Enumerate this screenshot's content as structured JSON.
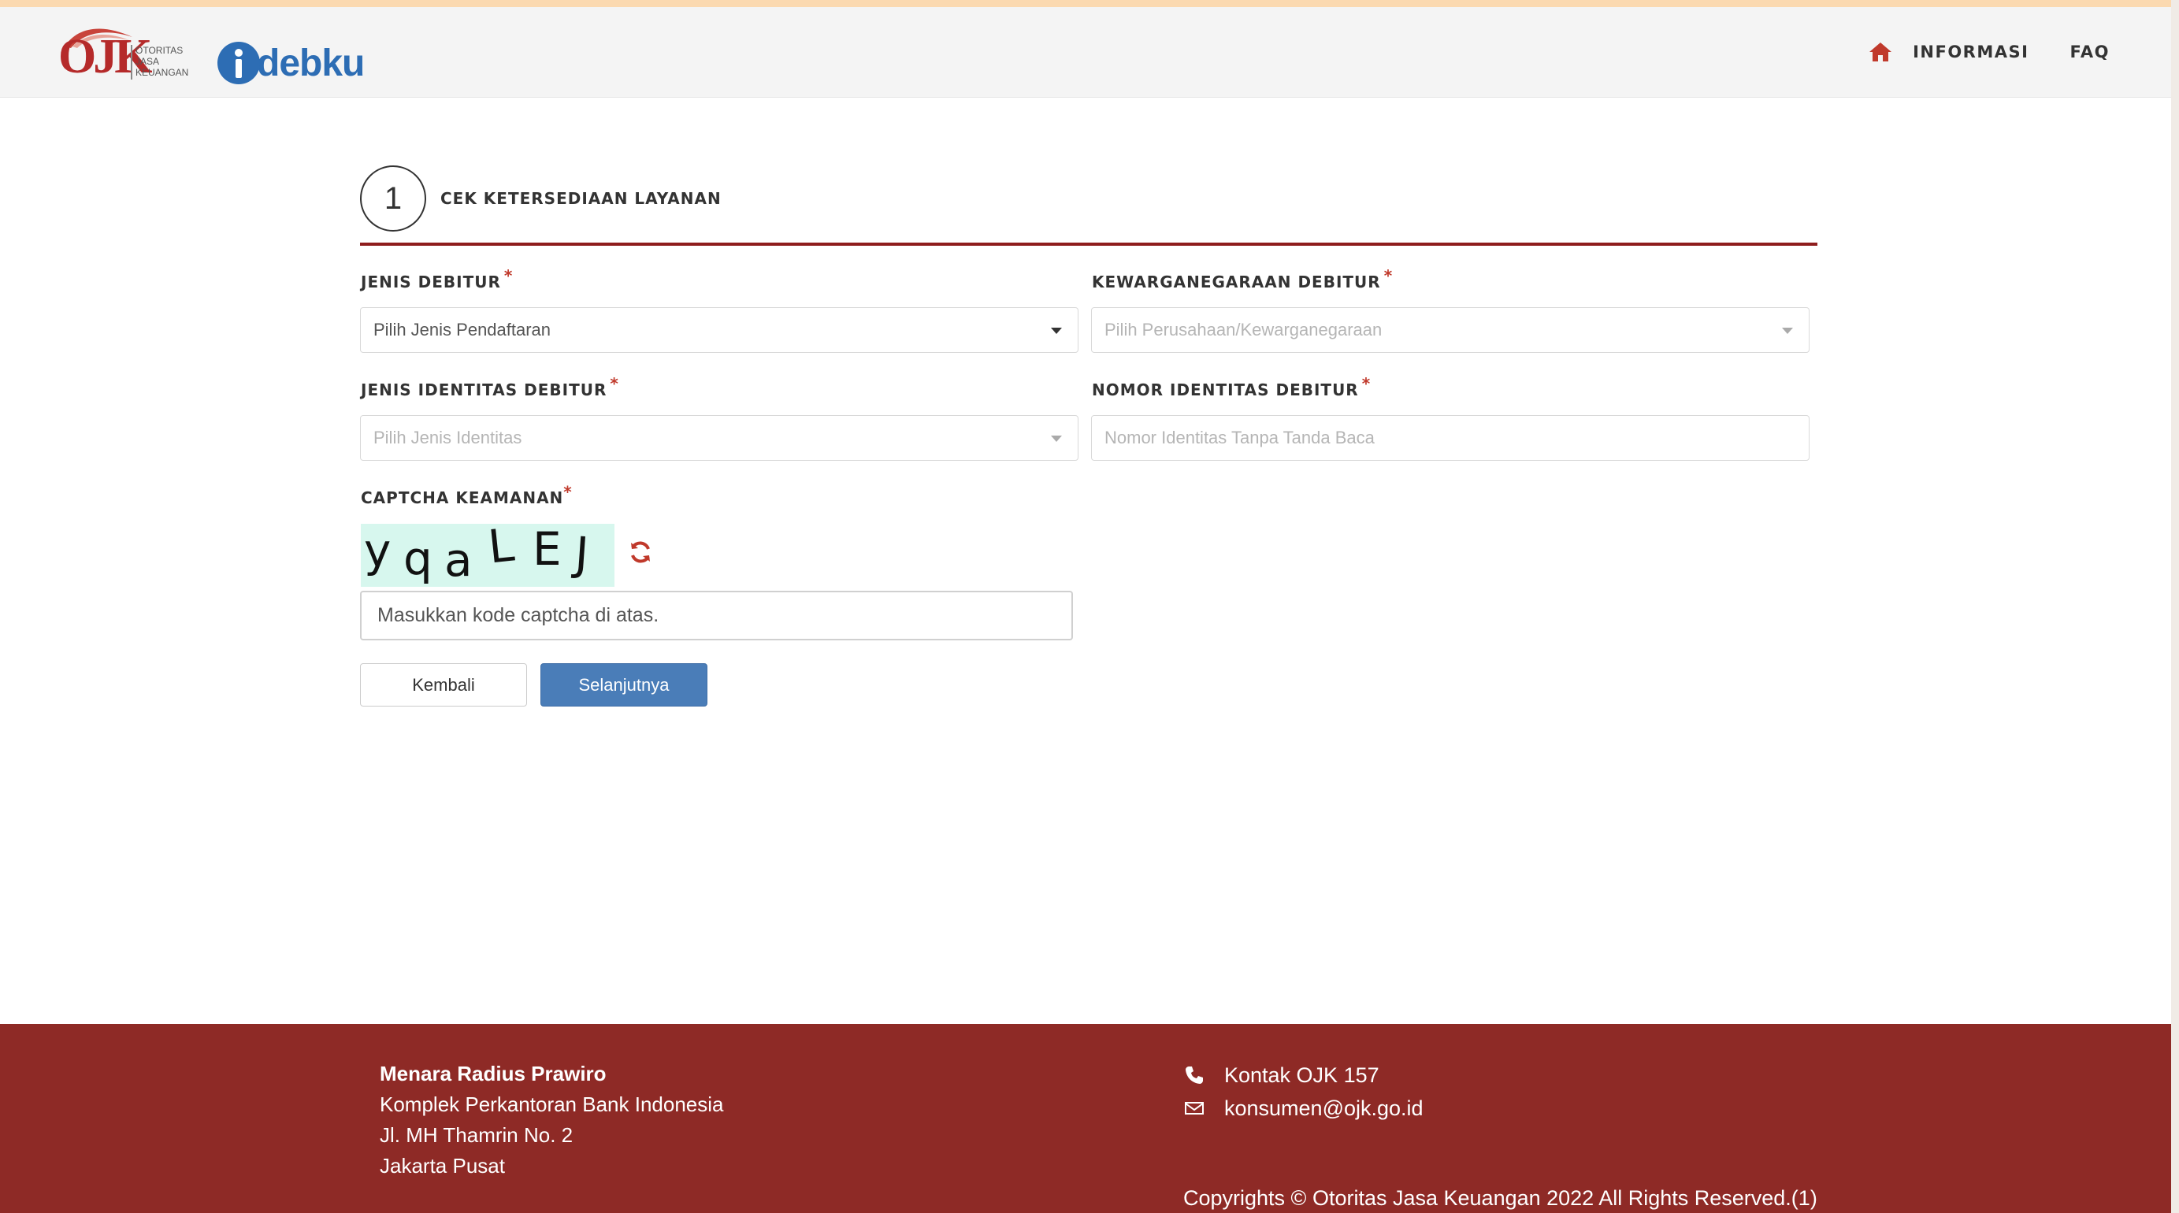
{
  "colors": {
    "brand_red": "#8e1d1d",
    "brand_blue": "#2d6db4",
    "primary_button": "#4a7db8",
    "footer_bg": "#8e2a26",
    "required": "#c0392b"
  },
  "header": {
    "logo_ojk_mark": "OJK",
    "logo_ojk_text": [
      "OTORITAS",
      "JASA",
      "KEUANGAN"
    ],
    "logo_idebku": "debku",
    "nav": {
      "home_icon": "home-icon",
      "informasi": "INFORMASI",
      "faq": "FAQ"
    }
  },
  "step": {
    "number": "1",
    "title": "CEK KETERSEDIAAN LAYANAN"
  },
  "form": {
    "required_mark": "*",
    "jenis_debitur": {
      "label": "JENIS DEBITUR",
      "value": "Pilih Jenis Pendaftaran"
    },
    "kewarganegaraan": {
      "label": "KEWARGANEGARAAN DEBITUR",
      "value": "Pilih Perusahaan/Kewarganegaraan"
    },
    "jenis_identitas": {
      "label": "JENIS IDENTITAS DEBITUR",
      "value": "Pilih Jenis Identitas"
    },
    "nomor_identitas": {
      "label": "NOMOR IDENTITAS DEBITUR",
      "placeholder": "Nomor Identitas Tanpa Tanda Baca"
    },
    "captcha": {
      "label": "CAPTCHA KEAMANAN",
      "chars": [
        "y",
        "q",
        "a",
        "L",
        "E",
        "J"
      ],
      "refresh_icon": "refresh-icon",
      "placeholder": "Masukkan kode captcha di atas."
    },
    "buttons": {
      "back": "Kembali",
      "next": "Selanjutnya"
    }
  },
  "footer": {
    "address_title": "Menara Radius Prawiro",
    "address_lines": [
      "Komplek Perkantoran Bank Indonesia",
      "Jl. MH Thamrin No. 2",
      "Jakarta Pusat"
    ],
    "phone_icon": "phone-icon",
    "phone": "Kontak OJK 157",
    "mail_icon": "mail-icon",
    "email": "konsumen@ojk.go.id",
    "copyright": "Copyrights © Otoritas Jasa Keuangan 2022 All Rights Reserved.(1)"
  }
}
